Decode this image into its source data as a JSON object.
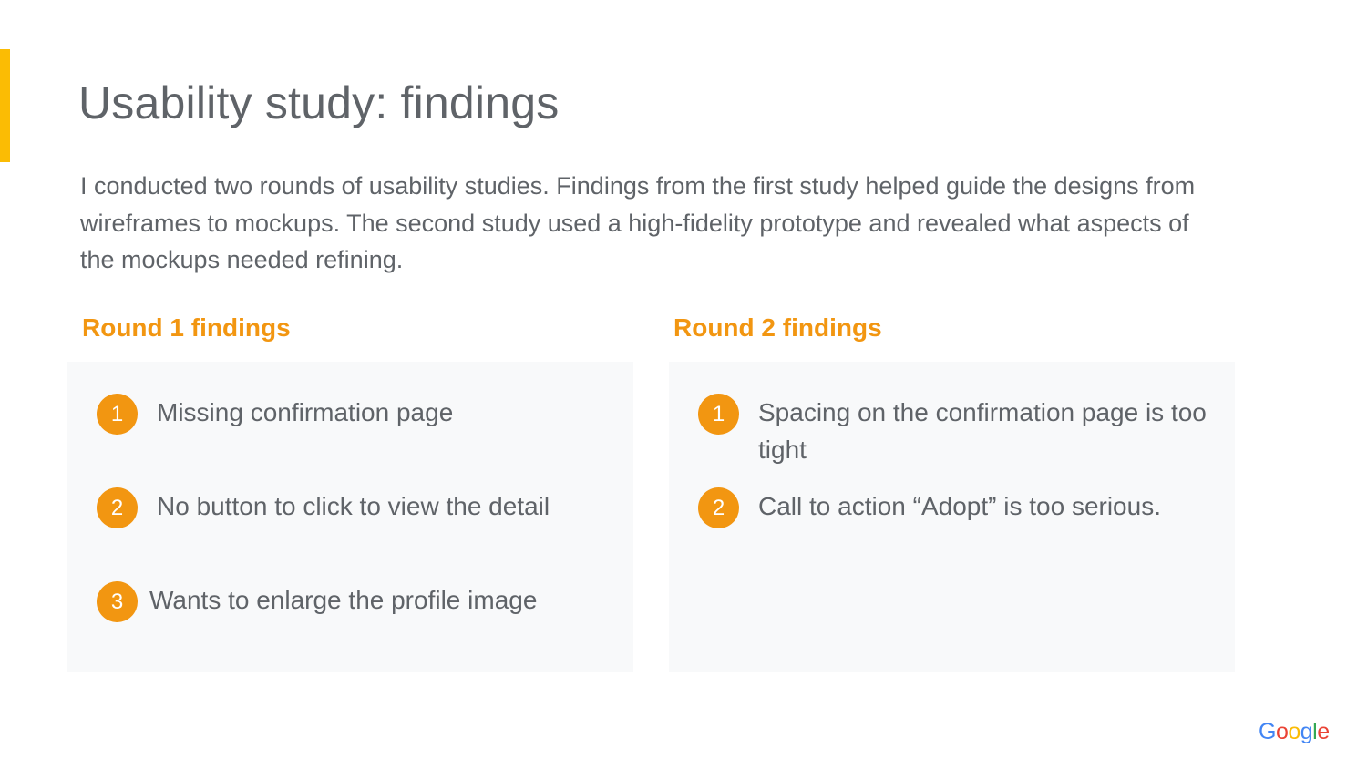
{
  "slide": {
    "title": "Usability study: findings",
    "intro": "I conducted two rounds of usability studies. Findings from the first study helped guide the designs from wireframes to mockups. The second study used a high-fidelity prototype and revealed what aspects of the mockups needed refining.",
    "colors": {
      "accent_bar": "#fbbc04",
      "heading": "#f29611",
      "badge": "#f29611",
      "panel_bg": "#f8f9fa",
      "text": "#5f6368"
    }
  },
  "round1": {
    "heading": "Round 1 findings",
    "items": [
      {
        "number": "1",
        "text": "Missing confirmation page"
      },
      {
        "number": "2",
        "text": "No button to click to view the detail"
      },
      {
        "number": "3",
        "text": "Wants to enlarge the profile image"
      }
    ]
  },
  "round2": {
    "heading": "Round 2 findings",
    "items": [
      {
        "number": "1",
        "text": "Spacing on the confirmation page is too tight"
      },
      {
        "number": "2",
        "text": "Call to action “Adopt” is too serious."
      }
    ]
  },
  "logo": {
    "letters": [
      "G",
      "o",
      "o",
      "g",
      "l",
      "e"
    ],
    "colors": [
      "#4285f4",
      "#ea4335",
      "#fbbc05",
      "#4285f4",
      "#34a853",
      "#ea4335"
    ]
  }
}
